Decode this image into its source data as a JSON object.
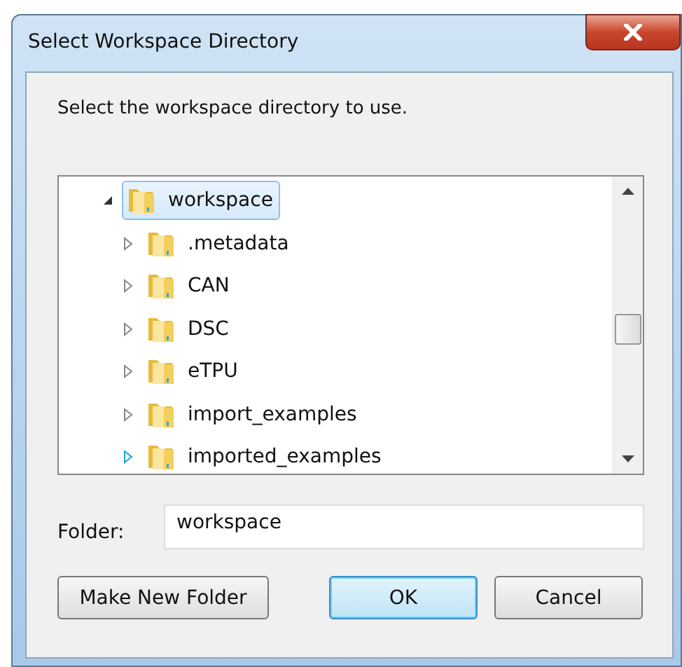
{
  "window": {
    "title": "Select Workspace Directory"
  },
  "instruction": "Select the workspace directory to use.",
  "tree": [
    {
      "label": "workspace",
      "expanded": true,
      "selected": true,
      "hover": false,
      "children": [
        {
          "label": ".metadata",
          "expanded": false,
          "selected": false,
          "hover": false
        },
        {
          "label": "CAN",
          "expanded": false,
          "selected": false,
          "hover": false
        },
        {
          "label": "DSC",
          "expanded": false,
          "selected": false,
          "hover": false
        },
        {
          "label": "eTPU",
          "expanded": false,
          "selected": false,
          "hover": false
        },
        {
          "label": "import_examples",
          "expanded": false,
          "selected": false,
          "hover": false
        },
        {
          "label": "imported_examples",
          "expanded": false,
          "selected": false,
          "hover": true
        }
      ]
    }
  ],
  "folder": {
    "label": "Folder:",
    "value": "workspace"
  },
  "buttons": [
    {
      "label": "Make New Folder",
      "default": false
    },
    {
      "label": "OK",
      "default": true
    },
    {
      "label": "Cancel",
      "default": false
    }
  ]
}
